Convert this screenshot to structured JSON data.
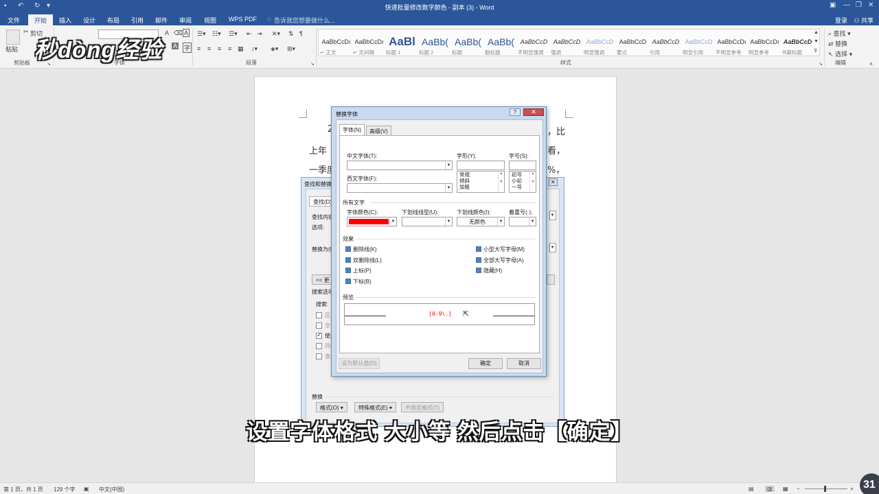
{
  "window": {
    "title": "快速批量修改数字颜色 - 副本 (3) - Word"
  },
  "tabs": {
    "items": [
      "文件",
      "开始",
      "插入",
      "设计",
      "布局",
      "引用",
      "邮件",
      "审阅",
      "视图",
      "WPS PDF"
    ],
    "active": "开始",
    "tell_me": "告诉我您想要做什么...",
    "login": "登录",
    "share": "共享"
  },
  "ribbon": {
    "clipboard": {
      "paste": "粘贴",
      "cut": "剪切",
      "group": "剪贴板"
    },
    "font_group": "字体",
    "paragraph_group": "段落",
    "styles_group": "样式",
    "editing_group": "编辑",
    "editing": {
      "find": "查找",
      "replace": "替换",
      "select": "选择"
    },
    "styles": [
      {
        "sample": "AaBbCcDı",
        "label": "↵ 正文"
      },
      {
        "sample": "AaBbCcDı",
        "label": "↵ 无间隔"
      },
      {
        "sample": "AaBl",
        "label": "标题 1"
      },
      {
        "sample": "AaBb(",
        "label": "标题 2"
      },
      {
        "sample": "AaBb(",
        "label": "标题"
      },
      {
        "sample": "AaBb(",
        "label": "副标题"
      },
      {
        "sample": "AaBbCcD",
        "label": "不明显强调"
      },
      {
        "sample": "AaBbCcD",
        "label": "强调"
      },
      {
        "sample": "AaBbCcD",
        "label": "明显强调"
      },
      {
        "sample": "AaBbCcD",
        "label": "要点"
      },
      {
        "sample": "AaBbCcD",
        "label": "引用"
      },
      {
        "sample": "AaBbCcD",
        "label": "明显引用"
      },
      {
        "sample": "AaBbCcDı",
        "label": "不明显参考"
      },
      {
        "sample": "AaBbCcDı",
        "label": "明显参考"
      },
      {
        "sample": "AaBbCcD",
        "label": "书籍标题"
      }
    ]
  },
  "watermark": "秒dòng经验",
  "document": {
    "lines": [
      "2",
      "，比",
      "上年",
      "看，",
      "一季度",
      "%，"
    ]
  },
  "find_replace": {
    "title": "查找和替换",
    "tab_find": "查找(D)",
    "find_label": "查找内容",
    "options_label": "选项:",
    "replace_label": "替换为(I)",
    "more_button": "<< 更",
    "search_options": "搜索选项",
    "search_label": "搜索:",
    "checks": [
      {
        "label": "区分",
        "checked": false
      },
      {
        "label": "全字",
        "checked": false
      },
      {
        "label": "使用",
        "checked": true
      },
      {
        "label": "同音",
        "checked": false
      },
      {
        "label": "查找",
        "checked": false
      }
    ],
    "replace_section": "替换",
    "format_button": "格式(O) ▾",
    "special_button": "特殊格式(E) ▾",
    "no_format_button": "不限定格式(T)"
  },
  "font_dialog": {
    "title": "替换字体",
    "help": "?",
    "close": "✕",
    "tab_font": "字体(N)",
    "tab_advanced": "高级(V)",
    "cn_font_label": "中文字体(T):",
    "style_label": "字形(Y):",
    "size_label": "字号(S):",
    "west_font_label": "西文字体(F):",
    "style_options": [
      "常规",
      "倾斜",
      "加粗"
    ],
    "size_options": [
      "初号",
      "小初",
      "一号"
    ],
    "all_text": "所有文字",
    "color_label": "字体颜色(C):",
    "underline_label": "下划线线型(U):",
    "underline_color_label": "下划线颜色(I):",
    "emphasis_label": "着重号(·);",
    "underline_color_value": "无颜色",
    "font_color": "#ff0000",
    "effects_label": "效果",
    "effects_left": [
      "删除线(K)",
      "双删除线(L)",
      "上标(P)",
      "下标(B)"
    ],
    "effects_right": [
      "小型大写字母(M)",
      "全部大写字母(A)",
      "隐藏(H)"
    ],
    "preview_label": "预览",
    "preview_text": "[0-9\\.]",
    "default_button": "设为默认值(D)",
    "ok_button": "确定",
    "cancel_button": "取消"
  },
  "subtitle": "设置字体格式   大小等   然后点击【确定】",
  "status": {
    "page": "第 1 页，共 1 页",
    "words": "129 个字",
    "language": "中文(中国)",
    "badge": "31"
  }
}
